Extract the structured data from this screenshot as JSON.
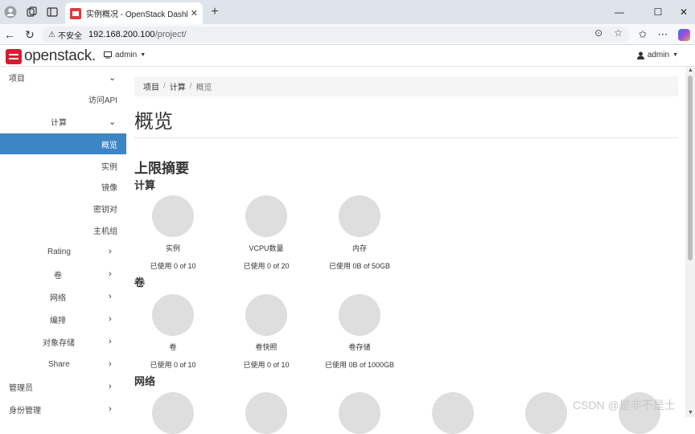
{
  "browser": {
    "tab_title": "实例概况 - OpenStack Dashboard",
    "tab_close": "✕",
    "new_tab": "+",
    "security_label": "不安全",
    "url_host": "192.168.200.100",
    "url_path": "/project/",
    "window_controls": {
      "minimize": "—",
      "maximize": "☐",
      "close": "✕"
    }
  },
  "header": {
    "logo_text": "openstack.",
    "project_menu": "admin",
    "user_menu": "admin"
  },
  "sidebar": {
    "project": "项目",
    "access_api": "访问API",
    "compute": "计算",
    "items": [
      "概览",
      "实例",
      "镜像",
      "密钥对",
      "主机组"
    ],
    "rating": "Rating",
    "volume": "卷",
    "network": "网络",
    "orchestration": "编排",
    "object_store": "对象存储",
    "share": "Share",
    "admin": "管理员",
    "identity": "身份管理"
  },
  "breadcrumb": [
    "项目",
    "计算",
    "概览"
  ],
  "page": {
    "title": "概览",
    "limits_heading": "上限摘要"
  },
  "quota_groups": [
    {
      "name": "计算",
      "items": [
        {
          "title": "实例",
          "usage": "已使用 0 of 10"
        },
        {
          "title": "VCPU数量",
          "usage": "已使用 0 of 20"
        },
        {
          "title": "内存",
          "usage": "已使用 0B of 50GB"
        }
      ]
    },
    {
      "name": "卷",
      "items": [
        {
          "title": "卷",
          "usage": "已使用 0 of 10"
        },
        {
          "title": "卷快照",
          "usage": "已使用 0 of 10"
        },
        {
          "title": "卷存储",
          "usage": "已使用 0B of 1000GB"
        }
      ]
    },
    {
      "name": "网络",
      "items": []
    }
  ],
  "watermark": "CSDN @是非不是土"
}
